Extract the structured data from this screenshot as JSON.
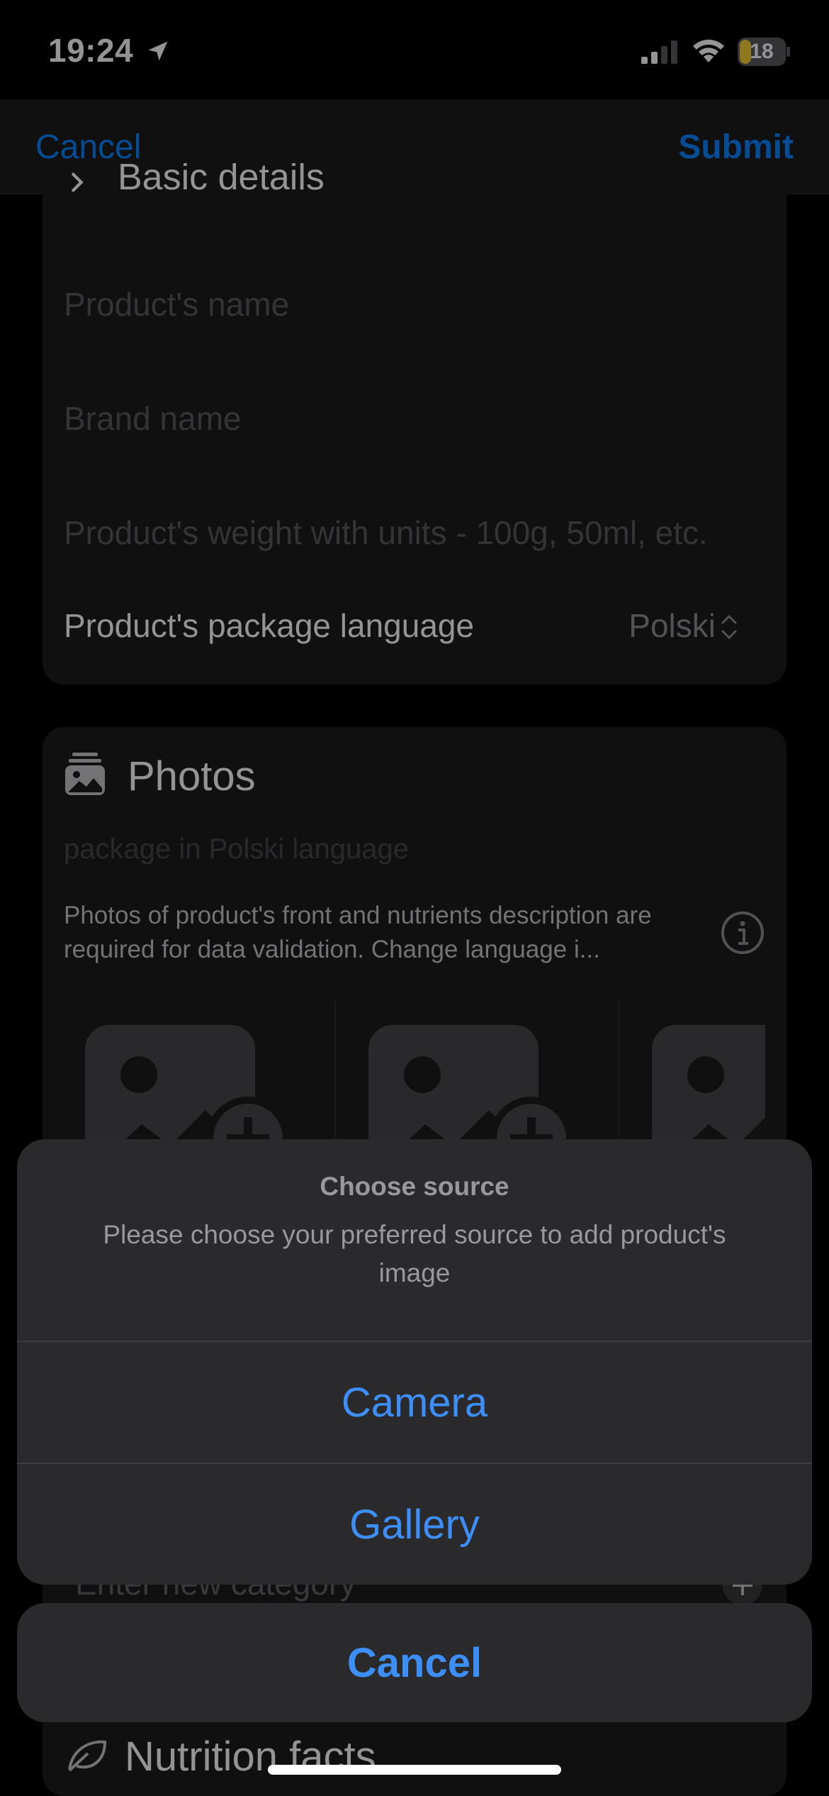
{
  "status_bar": {
    "time": "19:24",
    "battery_level": "18",
    "battery_color": "#f7d035"
  },
  "nav": {
    "cancel_label": "Cancel",
    "submit_label": "Submit"
  },
  "basic_details": {
    "title": "Basic details",
    "name_placeholder": "Product's name",
    "brand_placeholder": "Brand name",
    "weight_placeholder": "Product's weight with units - 100g, 50ml, etc.",
    "language_label": "Product's package language",
    "language_value": "Polski"
  },
  "photos": {
    "title": "Photos",
    "subtitle": "package in Polski language",
    "description": "Photos of product's front and nutrients description are required for data validation. Change language i..."
  },
  "categories": {
    "input_placeholder": "Enter new category"
  },
  "nutrition": {
    "title": "Nutrition facts"
  },
  "action_sheet": {
    "title": "Choose source",
    "message": "Please choose your preferred source to add product's image",
    "camera_label": "Camera",
    "gallery_label": "Gallery",
    "cancel_label": "Cancel"
  },
  "colors": {
    "accent": "#3e8ef7",
    "sheet_background": "#2a2a2c",
    "card_background": "#1c1c1e"
  }
}
